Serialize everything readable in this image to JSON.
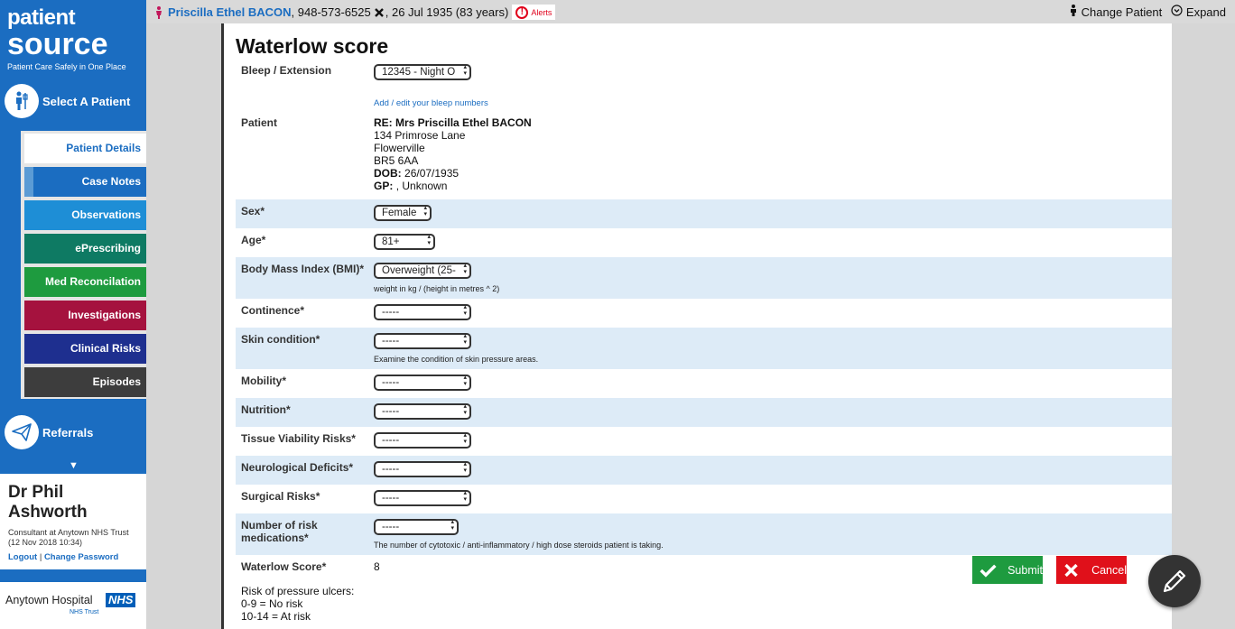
{
  "brand": {
    "line1": "patient",
    "line2": "source",
    "tagline": "Patient Care Safely in One Place"
  },
  "nav": {
    "select_patient": "Select A Patient",
    "referrals": "Referrals",
    "chevron": "▼"
  },
  "menu": [
    {
      "label": "Patient Details",
      "color": "#ffffff"
    },
    {
      "label": "Case Notes",
      "color": "#1b6dc1"
    },
    {
      "label": "Observations",
      "color": "#1e8ed6"
    },
    {
      "label": "ePrescribing",
      "color": "#0e7a63"
    },
    {
      "label": "Med Reconcilation",
      "color": "#1e9b3f"
    },
    {
      "label": "Investigations",
      "color": "#a5123e"
    },
    {
      "label": "Clinical Risks",
      "color": "#1e2f8f"
    },
    {
      "label": "Episodes",
      "color": "#3d3d3d"
    }
  ],
  "user": {
    "name": "Dr Phil Ashworth",
    "role": "Consultant at Anytown NHS Trust",
    "session": "(12 Nov 2018 10:34)",
    "logout": "Logout",
    "separator": "|",
    "change_password": "Change Password"
  },
  "hospital": {
    "name": "Anytown Hospital",
    "nhs": "NHS",
    "trust": "NHS Trust"
  },
  "topbar": {
    "patient_name": "Priscilla Ethel BACON",
    "patient_info_1": ", 948-573-6525",
    "patient_info_2": ", 26 Jul 1935 (83 years)",
    "alerts": "Alerts",
    "change_patient": "Change Patient",
    "expand": "Expand"
  },
  "form": {
    "title": "Waterlow score",
    "bleep_label": "Bleep / Extension",
    "bleep_value": "12345 - Night O",
    "bleep_link": "Add / edit your bleep numbers",
    "patient_label": "Patient",
    "patient_re": "RE: Mrs Priscilla Ethel BACON",
    "address": [
      "134 Primrose Lane",
      "Flowerville",
      "BR5 6AA"
    ],
    "dob_label": "DOB:",
    "dob_value": "26/07/1935",
    "gp_label": "GP:",
    "gp_value": ", Unknown",
    "sex_label": "Sex*",
    "sex_value": "Female",
    "age_label": "Age*",
    "age_value": "81+",
    "bmi_label": "Body Mass Index (BMI)*",
    "bmi_value": "Overweight (25-",
    "bmi_hint": "weight in kg / (height in metres ^ 2)",
    "continence_label": "Continence*",
    "skin_label": "Skin condition*",
    "skin_hint": "Examine the condition of skin pressure areas.",
    "mobility_label": "Mobility*",
    "nutrition_label": "Nutrition*",
    "tissue_label": "Tissue Viability Risks*",
    "neuro_label": "Neurological Deficits*",
    "surgical_label": "Surgical Risks*",
    "meds_label": "Number of risk medications*",
    "meds_hint": "The number of cytotoxic / anti-inflammatory / high dose steroids patient is taking.",
    "empty_option": "-----",
    "score_label": "Waterlow Score*",
    "score_value": "8",
    "risk_heading": "Risk of pressure ulcers:",
    "risk_lines": [
      "0-9 = No risk",
      "10-14 = At risk"
    ],
    "submit": "Submit",
    "cancel": "Cancel"
  }
}
